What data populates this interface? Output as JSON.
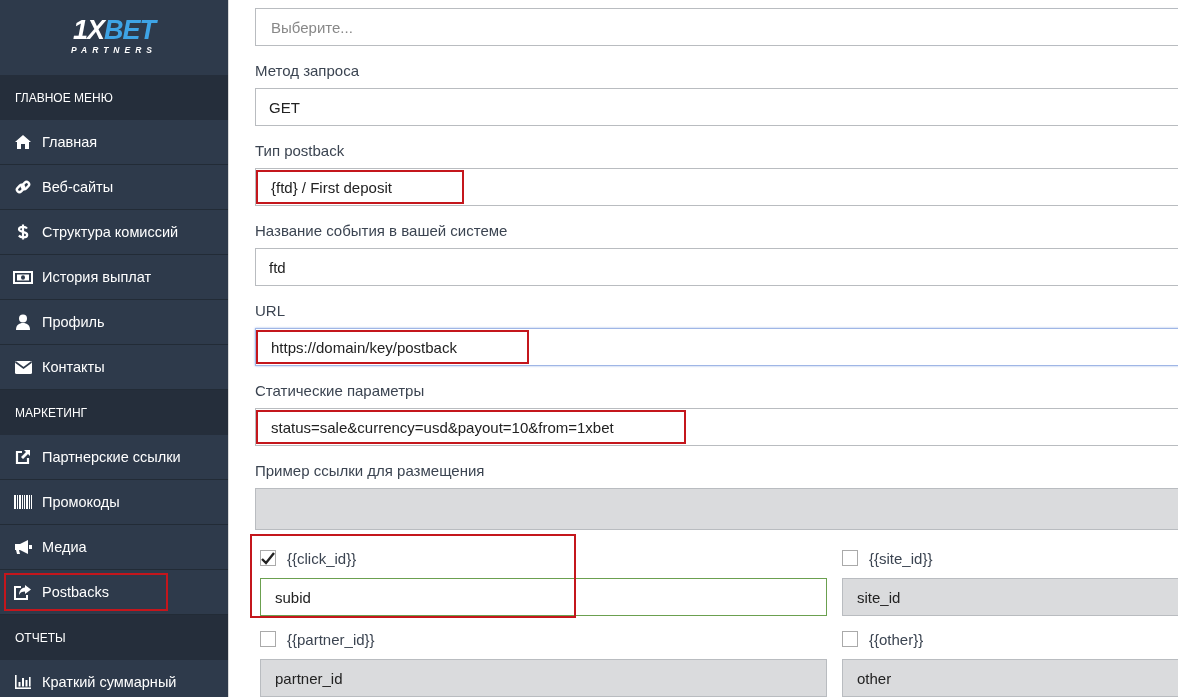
{
  "sidebar": {
    "logo": {
      "brand_light": "1X",
      "brand_accent": "BET",
      "subtitle": "PARTNERS"
    },
    "sections": [
      {
        "title": "ГЛАВНОЕ МЕНЮ",
        "items": [
          {
            "label": "Главная",
            "highlighted": false
          },
          {
            "label": "Веб-сайты",
            "highlighted": false
          },
          {
            "label": "Структура комиссий",
            "highlighted": false
          },
          {
            "label": "История выплат",
            "highlighted": false
          },
          {
            "label": "Профиль",
            "highlighted": false
          },
          {
            "label": "Контакты",
            "highlighted": false
          }
        ]
      },
      {
        "title": "МАРКЕТИНГ",
        "items": [
          {
            "label": "Партнерские ссылки",
            "highlighted": false
          },
          {
            "label": "Промокоды",
            "highlighted": false
          },
          {
            "label": "Медиа",
            "highlighted": false
          },
          {
            "label": "Postbacks",
            "highlighted": true
          }
        ]
      },
      {
        "title": "ОТЧЕТЫ",
        "items": [
          {
            "label": "Краткий суммарный",
            "highlighted": false
          }
        ]
      }
    ]
  },
  "form": {
    "fields": [
      {
        "placeholder": "Выберите...",
        "highlighted": false,
        "focused": false,
        "disabled": false
      },
      {
        "label": "Метод запроса",
        "value": "GET",
        "highlighted": false,
        "focused": false,
        "disabled": false
      },
      {
        "label": "Тип postback",
        "value": "{ftd} / First deposit",
        "highlighted": true,
        "focused": false,
        "disabled": false
      },
      {
        "label": "Название события в вашей системе",
        "value": "ftd",
        "highlighted": false,
        "focused": false,
        "disabled": false
      },
      {
        "label": "URL",
        "value": "https://domain/key/postback",
        "highlighted": true,
        "focused": true,
        "disabled": false
      },
      {
        "label": "Статические параметры",
        "value": "status=sale&currency=usd&payout=10&from=1xbet",
        "highlighted": true,
        "focused": false,
        "disabled": false
      },
      {
        "label": "Пример ссылки для размещения",
        "highlighted": false,
        "focused": false,
        "disabled": true
      }
    ],
    "parameters": [
      {
        "label": "{{click_id}}",
        "checked": true,
        "value": "subid",
        "highlighted": true
      },
      {
        "label": "{{site_id}}",
        "checked": false,
        "value": "site_id",
        "highlighted": false
      },
      {
        "label": "{{partner_id}}",
        "checked": false,
        "value": "partner_id",
        "highlighted": false
      },
      {
        "label": "{{other}}",
        "checked": false,
        "value": "other",
        "highlighted": false
      }
    ]
  }
}
